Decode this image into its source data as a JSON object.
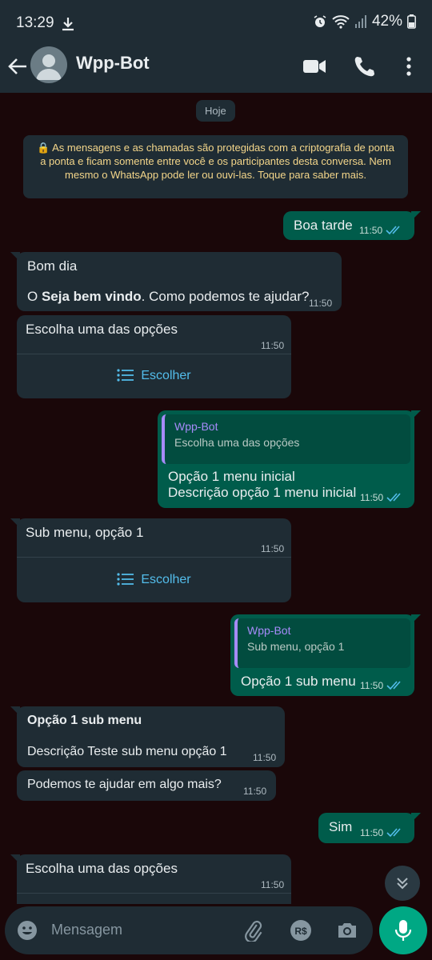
{
  "status": {
    "time": "13:29",
    "battery": "42%"
  },
  "header": {
    "title": "Wpp-Bot"
  },
  "chat": {
    "date_pill": "Hoje",
    "notice": "🔒 As mensagens e as chamadas são protegidas com a criptografia de ponta a ponta e ficam somente entre você e os participantes desta conversa. Nem mesmo o WhatsApp pode ler ou ouvi-las. Toque para saber mais.",
    "m1": {
      "text": "Boa tarde",
      "time": "11:50"
    },
    "m2": {
      "line1": "Bom dia",
      "line2_pre": "O ",
      "line2_bold": "Seja bem vindo",
      "line2_post": ". Como podemos te ajudar?",
      "time": "11:50"
    },
    "m3": {
      "text": "Escolha uma das opções",
      "time": "11:50",
      "button": "Escolher"
    },
    "m4": {
      "quote_name": "Wpp-Bot",
      "quote_text": "Escolha uma das opções",
      "line1": "Opção 1 menu inicial",
      "line2": "Descrição opção 1 menu inicial",
      "time": "11:50"
    },
    "m5": {
      "text": "Sub menu, opção 1",
      "time": "11:50",
      "button": "Escolher"
    },
    "m6": {
      "quote_name": "Wpp-Bot",
      "quote_text": "Sub menu, opção 1",
      "text": "Opção 1 sub menu",
      "time": "11:50"
    },
    "m7": {
      "title": "Opção 1 sub menu",
      "text": "Descrição Teste sub menu opção 1",
      "time": "11:50"
    },
    "m8": {
      "text": "Podemos te ajudar em algo mais?",
      "time": "11:50"
    },
    "m9": {
      "text": "Sim",
      "time": "11:50"
    },
    "m10": {
      "text": "Escolha uma das opções",
      "time": "11:50"
    }
  },
  "input": {
    "placeholder": "Mensagem"
  },
  "colors": {
    "incoming": "#1f2c34",
    "outgoing": "#005c4b",
    "accent": "#00a884",
    "link": "#53bdeb"
  }
}
